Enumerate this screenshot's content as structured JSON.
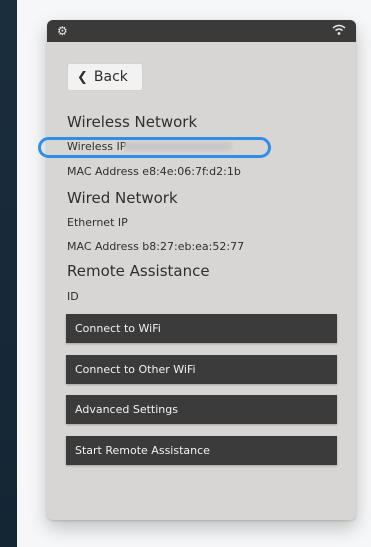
{
  "header": {
    "settings_icon": "gear-icon",
    "wifi_icon": "wifi-icon"
  },
  "back_button": {
    "label": "Back",
    "icon": "chevron-left-icon"
  },
  "wireless": {
    "heading": "Wireless Network",
    "ip_label": "Wireless IP",
    "mac": "MAC Address e8:4e:06:7f:d2:1b"
  },
  "wired": {
    "heading": "Wired Network",
    "ip_label": "Ethernet IP",
    "mac": "MAC Address b8:27:eb:ea:52:77"
  },
  "remote": {
    "heading": "Remote Assistance",
    "id_label": "ID"
  },
  "buttons": [
    {
      "label": "Connect to WiFi"
    },
    {
      "label": "Connect to Other WiFi"
    },
    {
      "label": "Advanced Settings"
    },
    {
      "label": "Start Remote Assistance"
    }
  ],
  "colors": {
    "highlight": "#2f8ee6",
    "button_bg": "#3b3b3b",
    "panel_bg": "#d7d6d4"
  }
}
